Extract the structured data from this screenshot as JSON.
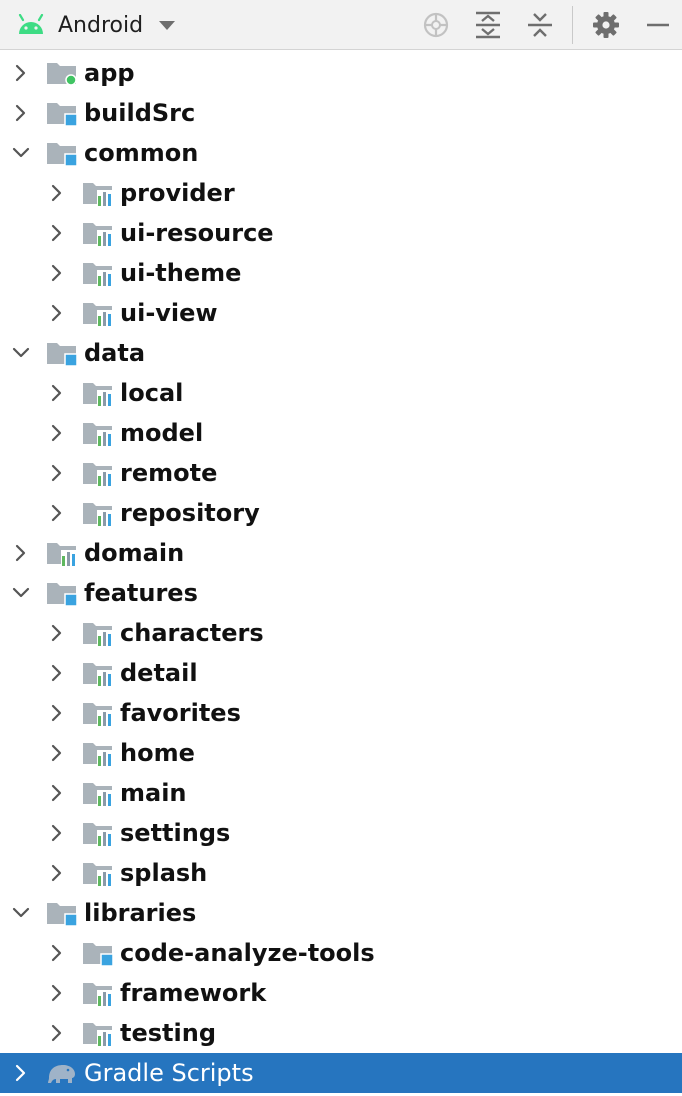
{
  "toolbar": {
    "view_label": "Android",
    "icons": [
      "android-icon",
      "chevron-down-icon",
      "locate-icon",
      "expand-all-icon",
      "collapse-all-icon",
      "gear-icon",
      "minimize-icon"
    ]
  },
  "colors": {
    "selection": "#2675bf",
    "folder": "#aab3ba",
    "module_marker": "#3aa3e0",
    "app_marker": "#40c463",
    "android_green": "#3ddc84"
  },
  "tree": {
    "items": [
      {
        "label": "app",
        "expanded": false,
        "icon": "app-module-icon"
      },
      {
        "label": "buildSrc",
        "expanded": false,
        "icon": "module-folder-icon"
      },
      {
        "label": "common",
        "expanded": true,
        "icon": "module-folder-icon"
      },
      {
        "label": "provider",
        "expanded": false,
        "icon": "library-module-icon"
      },
      {
        "label": "ui-resource",
        "expanded": false,
        "icon": "library-module-icon"
      },
      {
        "label": "ui-theme",
        "expanded": false,
        "icon": "library-module-icon"
      },
      {
        "label": "ui-view",
        "expanded": false,
        "icon": "library-module-icon"
      },
      {
        "label": "data",
        "expanded": true,
        "icon": "module-folder-icon"
      },
      {
        "label": "local",
        "expanded": false,
        "icon": "library-module-icon"
      },
      {
        "label": "model",
        "expanded": false,
        "icon": "library-module-icon"
      },
      {
        "label": "remote",
        "expanded": false,
        "icon": "library-module-icon"
      },
      {
        "label": "repository",
        "expanded": false,
        "icon": "library-module-icon"
      },
      {
        "label": "domain",
        "expanded": false,
        "icon": "library-module-icon"
      },
      {
        "label": "features",
        "expanded": true,
        "icon": "module-folder-icon"
      },
      {
        "label": "characters",
        "expanded": false,
        "icon": "library-module-icon"
      },
      {
        "label": "detail",
        "expanded": false,
        "icon": "library-module-icon"
      },
      {
        "label": "favorites",
        "expanded": false,
        "icon": "library-module-icon"
      },
      {
        "label": "home",
        "expanded": false,
        "icon": "library-module-icon"
      },
      {
        "label": "main",
        "expanded": false,
        "icon": "library-module-icon"
      },
      {
        "label": "settings",
        "expanded": false,
        "icon": "library-module-icon"
      },
      {
        "label": "splash",
        "expanded": false,
        "icon": "library-module-icon"
      },
      {
        "label": "libraries",
        "expanded": true,
        "icon": "module-folder-icon"
      },
      {
        "label": "code-analyze-tools",
        "expanded": false,
        "icon": "module-folder-icon"
      },
      {
        "label": "framework",
        "expanded": false,
        "icon": "library-module-icon"
      },
      {
        "label": "testing",
        "expanded": false,
        "icon": "library-module-icon"
      },
      {
        "label": "Gradle Scripts",
        "expanded": false,
        "icon": "gradle-elephant-icon",
        "selected": true
      }
    ]
  }
}
